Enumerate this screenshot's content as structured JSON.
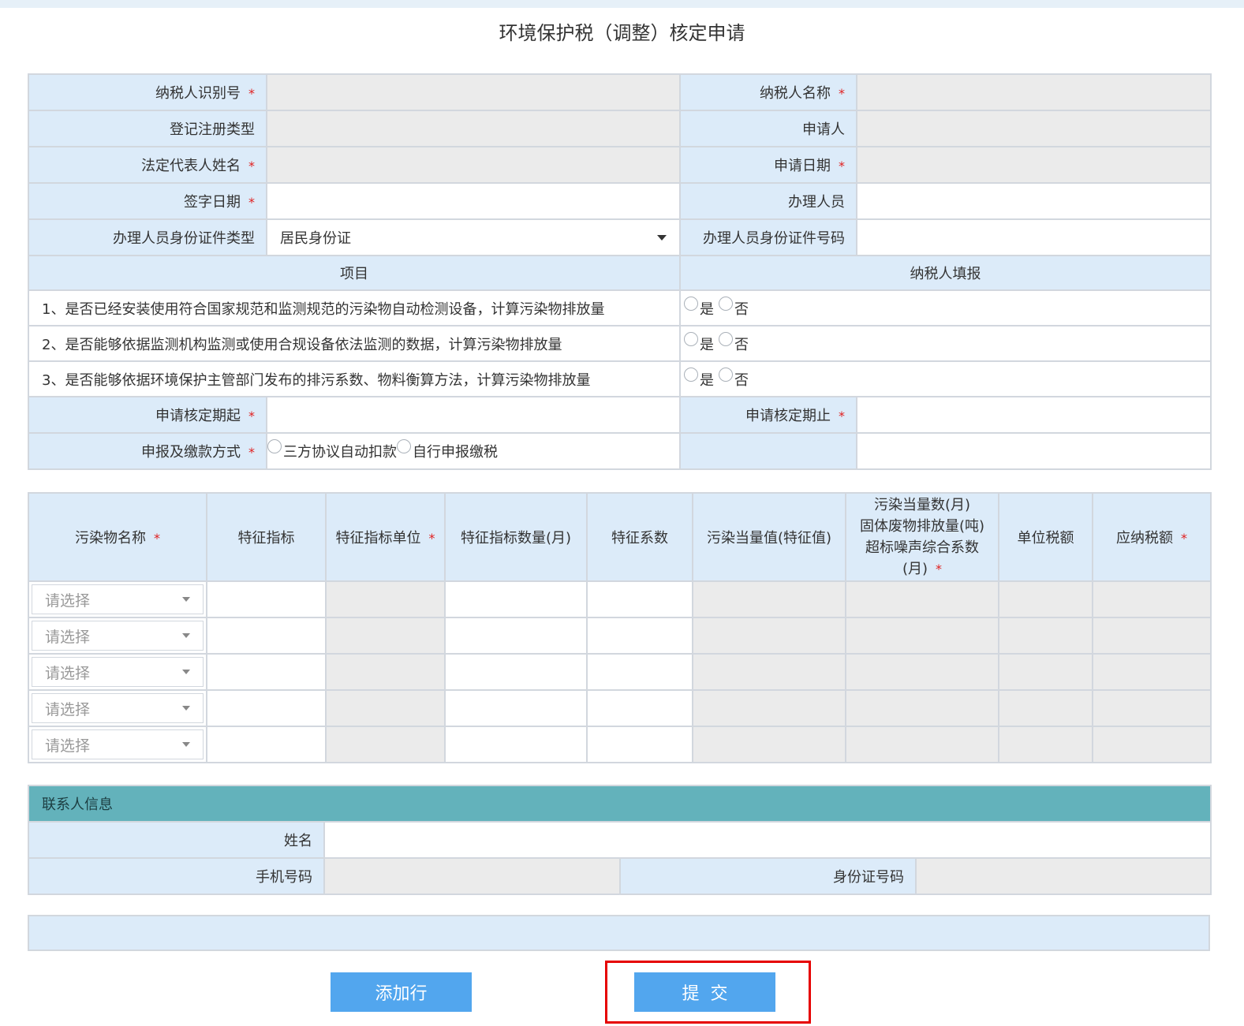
{
  "page_title": "环境保护税（调整）核定申请",
  "form": {
    "taxpayer_id_label": "纳税人识别号",
    "taxpayer_name_label": "纳税人名称",
    "reg_type_label": "登记注册类型",
    "applicant_label": "申请人",
    "legal_rep_label": "法定代表人姓名",
    "apply_date_label": "申请日期",
    "sign_date_label": "签字日期",
    "handler_label": "办理人员",
    "handler_id_type_label": "办理人员身份证件类型",
    "handler_id_type_value": "居民身份证",
    "handler_id_no_label": "办理人员身份证件号码",
    "item_header": "项目",
    "fill_header": "纳税人填报",
    "questions": [
      "1、是否已经安装使用符合国家规范和监测规范的污染物自动检测设备，计算污染物排放量",
      "2、是否能够依据监测机构监测或使用合规设备依法监测的数据，计算污染物排放量",
      "3、是否能够依据环境保护主管部门发布的排污系数、物料衡算方法，计算污染物排放量"
    ],
    "yes": "是",
    "no": "否",
    "period_start_label": "申请核定期起",
    "period_end_label": "申请核定期止",
    "payment_method_label": "申报及缴款方式",
    "payment_opt1": "三方协议自动扣款",
    "payment_opt2": "自行申报缴税",
    "required_mark": "*"
  },
  "pollutant_table": {
    "headers": {
      "name": "污染物名称",
      "indicator": "特征指标",
      "indicator_unit": "特征指标单位",
      "indicator_qty": "特征指标数量(月)",
      "coefficient": "特征系数",
      "equiv_value": "污染当量值(特征值)",
      "equiv_line1": "污染当量数(月)",
      "equiv_line2": "固体废物排放量(吨)",
      "equiv_line3": "超标噪声综合系数",
      "equiv_line4": "(月)",
      "unit_tax": "单位税额",
      "tax_due": "应纳税额"
    },
    "placeholder": "请选择"
  },
  "contact": {
    "header": "联系人信息",
    "name_label": "姓名",
    "phone_label": "手机号码",
    "id_label": "身份证号码"
  },
  "buttons": {
    "add_row": "添加行",
    "submit": "提  交"
  }
}
